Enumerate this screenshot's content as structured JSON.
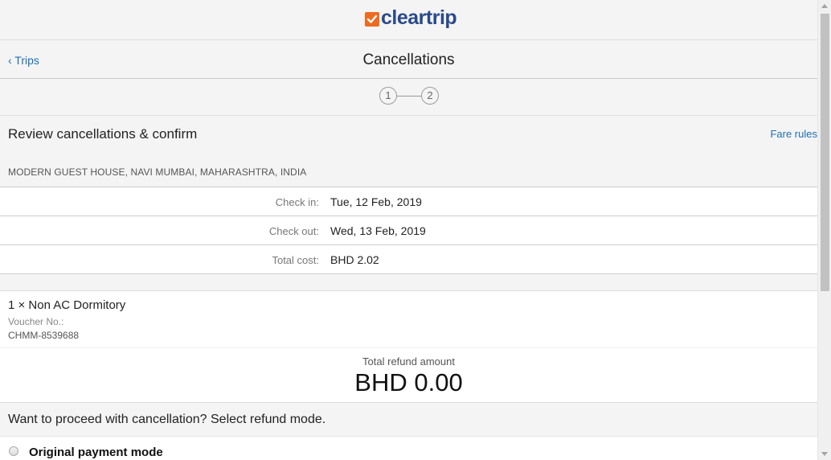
{
  "brand": {
    "name": "cleartrip",
    "logo_color": "#ee6b1f",
    "text_color": "#2a4a8a"
  },
  "nav": {
    "back_label": "‹ Trips",
    "title": "Cancellations"
  },
  "stepper": {
    "steps": [
      "1",
      "2"
    ]
  },
  "review": {
    "title": "Review cancellations & confirm",
    "fare_rules_label": "Fare rules",
    "hotel_name": "MODERN GUEST HOUSE, NAVI MUMBAI, MAHARASHTRA, INDIA"
  },
  "details": [
    {
      "label": "Check in:",
      "value": "Tue, 12 Feb, 2019"
    },
    {
      "label": "Check out:",
      "value": "Wed, 13 Feb, 2019"
    },
    {
      "label": "Total cost:",
      "value": "BHD 2.02"
    }
  ],
  "room": {
    "name": "1 × Non AC Dormitory",
    "voucher_label": "Voucher No.:",
    "voucher_no": "CHMM-8539688"
  },
  "refund": {
    "label": "Total refund amount",
    "amount": "BHD 0.00"
  },
  "proceed": {
    "question": "Want to proceed with cancellation? Select refund mode.",
    "option_label": "Original payment mode"
  },
  "colors": {
    "link": "#1f6fb2"
  }
}
